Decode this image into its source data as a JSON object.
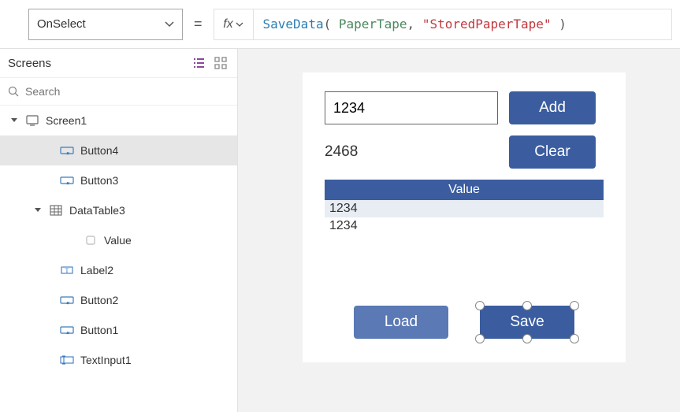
{
  "topbar": {
    "property": "OnSelect",
    "fx_label": "fx",
    "formula": {
      "fn": "SaveData",
      "arg_ident": "PaperTape",
      "arg_string": "\"StoredPaperTape\""
    }
  },
  "side": {
    "title": "Screens",
    "search_placeholder": "Search",
    "items": [
      {
        "indent": 14,
        "chev": "▾",
        "icon": "screen-icon",
        "label": "Screen1",
        "selected": false
      },
      {
        "indent": 58,
        "chev": "",
        "icon": "button-icon",
        "label": "Button4",
        "selected": true
      },
      {
        "indent": 58,
        "chev": "",
        "icon": "button-icon",
        "label": "Button3",
        "selected": false
      },
      {
        "indent": 44,
        "chev": "▾",
        "icon": "datatable-icon",
        "label": "DataTable3",
        "selected": false
      },
      {
        "indent": 88,
        "chev": "",
        "icon": "column-icon",
        "label": "Value",
        "selected": false
      },
      {
        "indent": 58,
        "chev": "",
        "icon": "label-icon",
        "label": "Label2",
        "selected": false
      },
      {
        "indent": 58,
        "chev": "",
        "icon": "button-icon",
        "label": "Button2",
        "selected": false
      },
      {
        "indent": 58,
        "chev": "",
        "icon": "button-icon",
        "label": "Button1",
        "selected": false
      },
      {
        "indent": 58,
        "chev": "",
        "icon": "textinput-icon",
        "label": "TextInput1",
        "selected": false
      }
    ]
  },
  "canvas": {
    "textinput_value": "1234",
    "add_label": "Add",
    "result_value": "2468",
    "clear_label": "Clear",
    "table_header": "Value",
    "table_rows": [
      "1234",
      "1234"
    ],
    "load_label": "Load",
    "save_label": "Save"
  }
}
